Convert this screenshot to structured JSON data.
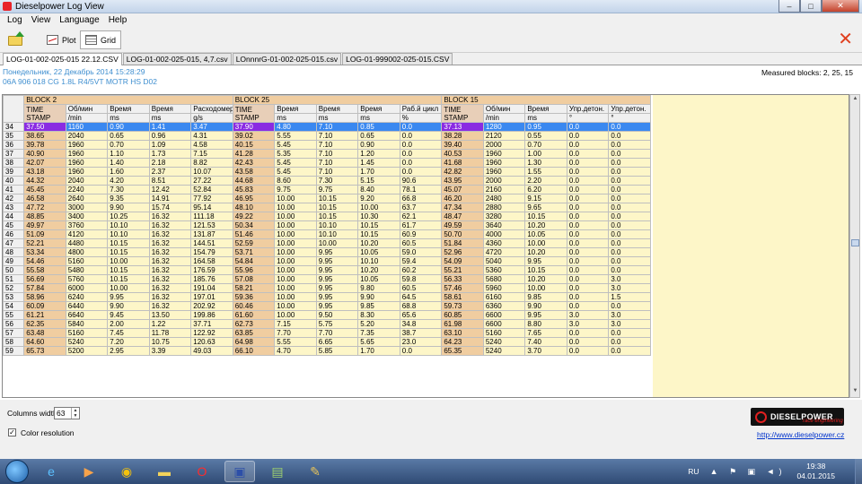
{
  "window": {
    "title": "Dieselpower Log View",
    "min": "‒",
    "max": "□",
    "close": "✕"
  },
  "menu": [
    "Log",
    "View",
    "Language",
    "Help"
  ],
  "toolbar": {
    "plot_label": "Plot",
    "grid_label": "Grid",
    "close": "✕"
  },
  "tabs": [
    "LOG-01-002-025-015 22.12.CSV",
    "LOG-01-002-025-015, 4,7.csv",
    "LOnnnrG-01-002-025-015.csv",
    "LOG-01-999002-025-015.CSV"
  ],
  "info": {
    "line1": "Понедельник, 22 Декабрь 2014 15:28:29",
    "line2": "06A 906 018 CG  1.8L R4/5VT MOTR HS D02",
    "measured": "Measured blocks: 2, 25, 15"
  },
  "grid": {
    "blocks": [
      {
        "label": "BLOCK 2",
        "cols": 5
      },
      {
        "label": "BLOCK 25",
        "cols": 5
      },
      {
        "label": "BLOCK 15",
        "cols": 5
      }
    ],
    "headers": [
      "TIME STAMP",
      "Об/мин",
      "Время",
      "Время",
      "Расходомер",
      "TIME STAMP",
      "Время",
      "Время",
      "Время",
      "Раб.й цикл",
      "TIME STAMP",
      "Об/мин",
      "Время",
      "Упр.детон.",
      "Упр.детон."
    ],
    "units": [
      "",
      "/min",
      "ms",
      "ms",
      "g/s",
      "",
      "ms",
      "ms",
      "ms",
      "%",
      "",
      "/min",
      "ms",
      "°",
      "°"
    ],
    "selected_row": "34",
    "rows": [
      [
        "34",
        "37.50",
        "1160",
        "0.90",
        "1.41",
        "3.47",
        "37.90",
        "4.80",
        "7.10",
        "0.85",
        "0.0",
        "37.13",
        "1280",
        "0.95",
        "0.0",
        "0.0"
      ],
      [
        "35",
        "38.65",
        "2040",
        "0.65",
        "0.96",
        "4.31",
        "39.02",
        "5.55",
        "7.10",
        "0.65",
        "0.0",
        "38.28",
        "2120",
        "0.55",
        "0.0",
        "0.0"
      ],
      [
        "36",
        "39.78",
        "1960",
        "0.70",
        "1.09",
        "4.58",
        "40.15",
        "5.45",
        "7.10",
        "0.90",
        "0.0",
        "39.40",
        "2000",
        "0.70",
        "0.0",
        "0.0"
      ],
      [
        "37",
        "40.90",
        "1960",
        "1.10",
        "1.73",
        "7.15",
        "41.28",
        "5.35",
        "7.10",
        "1.20",
        "0.0",
        "40.53",
        "1960",
        "1.00",
        "0.0",
        "0.0"
      ],
      [
        "38",
        "42.07",
        "1960",
        "1.40",
        "2.18",
        "8.82",
        "42.43",
        "5.45",
        "7.10",
        "1.45",
        "0.0",
        "41.68",
        "1960",
        "1.30",
        "0.0",
        "0.0"
      ],
      [
        "39",
        "43.18",
        "1960",
        "1.60",
        "2.37",
        "10.07",
        "43.58",
        "5.45",
        "7.10",
        "1.70",
        "0.0",
        "42.82",
        "1960",
        "1.55",
        "0.0",
        "0.0"
      ],
      [
        "40",
        "44.32",
        "2040",
        "4.20",
        "8.51",
        "27.22",
        "44.68",
        "8.60",
        "7.30",
        "5.15",
        "90.6",
        "43.95",
        "2000",
        "2.20",
        "0.0",
        "0.0"
      ],
      [
        "41",
        "45.45",
        "2240",
        "7.30",
        "12.42",
        "52.84",
        "45.83",
        "9.75",
        "9.75",
        "8.40",
        "78.1",
        "45.07",
        "2160",
        "6.20",
        "0.0",
        "0.0"
      ],
      [
        "42",
        "46.58",
        "2640",
        "9.35",
        "14.91",
        "77.92",
        "46.95",
        "10.00",
        "10.15",
        "9.20",
        "66.8",
        "46.20",
        "2480",
        "9.15",
        "0.0",
        "0.0"
      ],
      [
        "43",
        "47.72",
        "3000",
        "9.90",
        "15.74",
        "95.14",
        "48.10",
        "10.00",
        "10.15",
        "10.00",
        "63.7",
        "47.34",
        "2880",
        "9.65",
        "0.0",
        "0.0"
      ],
      [
        "44",
        "48.85",
        "3400",
        "10.25",
        "16.32",
        "111.18",
        "49.22",
        "10.00",
        "10.15",
        "10.30",
        "62.1",
        "48.47",
        "3280",
        "10.15",
        "0.0",
        "0.0"
      ],
      [
        "45",
        "49.97",
        "3760",
        "10.10",
        "16.32",
        "121.53",
        "50.34",
        "10.00",
        "10.10",
        "10.15",
        "61.7",
        "49.59",
        "3640",
        "10.20",
        "0.0",
        "0.0"
      ],
      [
        "46",
        "51.09",
        "4120",
        "10.10",
        "16.32",
        "131.87",
        "51.46",
        "10.00",
        "10.10",
        "10.15",
        "60.9",
        "50.70",
        "4000",
        "10.05",
        "0.0",
        "0.0"
      ],
      [
        "47",
        "52.21",
        "4480",
        "10.15",
        "16.32",
        "144.51",
        "52.59",
        "10.00",
        "10.00",
        "10.20",
        "60.5",
        "51.84",
        "4360",
        "10.00",
        "0.0",
        "0.0"
      ],
      [
        "48",
        "53.34",
        "4800",
        "10.15",
        "16.32",
        "154.79",
        "53.71",
        "10.00",
        "9.95",
        "10.05",
        "59.0",
        "52.96",
        "4720",
        "10.20",
        "0.0",
        "0.0"
      ],
      [
        "49",
        "54.46",
        "5160",
        "10.00",
        "16.32",
        "164.58",
        "54.84",
        "10.00",
        "9.95",
        "10.10",
        "59.4",
        "54.09",
        "5040",
        "9.95",
        "0.0",
        "0.0"
      ],
      [
        "50",
        "55.58",
        "5480",
        "10.15",
        "16.32",
        "176.59",
        "55.96",
        "10.00",
        "9.95",
        "10.20",
        "60.2",
        "55.21",
        "5360",
        "10.15",
        "0.0",
        "0.0"
      ],
      [
        "51",
        "56.69",
        "5760",
        "10.15",
        "16.32",
        "185.76",
        "57.08",
        "10.00",
        "9.95",
        "10.05",
        "59.8",
        "56.33",
        "5680",
        "10.20",
        "0.0",
        "3.0"
      ],
      [
        "52",
        "57.84",
        "6000",
        "10.00",
        "16.32",
        "191.04",
        "58.21",
        "10.00",
        "9.95",
        "9.80",
        "60.5",
        "57.46",
        "5960",
        "10.00",
        "0.0",
        "3.0"
      ],
      [
        "53",
        "58.96",
        "6240",
        "9.95",
        "16.32",
        "197.01",
        "59.36",
        "10.00",
        "9.95",
        "9.90",
        "64.5",
        "58.61",
        "6160",
        "9.85",
        "0.0",
        "1.5"
      ],
      [
        "54",
        "60.09",
        "6440",
        "9.90",
        "16.32",
        "202.92",
        "60.46",
        "10.00",
        "9.95",
        "9.85",
        "68.8",
        "59.73",
        "6360",
        "9.90",
        "0.0",
        "0.0"
      ],
      [
        "55",
        "61.21",
        "6640",
        "9.45",
        "13.50",
        "199.86",
        "61.60",
        "10.00",
        "9.50",
        "8.30",
        "65.6",
        "60.85",
        "6600",
        "9.95",
        "3.0",
        "3.0"
      ],
      [
        "56",
        "62.35",
        "5840",
        "2.00",
        "1.22",
        "37.71",
        "62.73",
        "7.15",
        "5.75",
        "5.20",
        "34.8",
        "61.98",
        "6600",
        "8.80",
        "3.0",
        "3.0"
      ],
      [
        "57",
        "63.48",
        "5160",
        "7.45",
        "11.78",
        "122.92",
        "63.85",
        "7.70",
        "7.70",
        "7.35",
        "38.7",
        "63.10",
        "5160",
        "7.65",
        "0.0",
        "0.0"
      ],
      [
        "58",
        "64.60",
        "5240",
        "7.20",
        "10.75",
        "120.63",
        "64.98",
        "5.55",
        "6.65",
        "5.65",
        "23.0",
        "64.23",
        "5240",
        "7.40",
        "0.0",
        "0.0"
      ],
      [
        "59",
        "65.73",
        "5200",
        "2.95",
        "3.39",
        "49.03",
        "66.10",
        "4.70",
        "5.85",
        "1.70",
        "0.0",
        "65.35",
        "5240",
        "3.70",
        "0.0",
        "0.0"
      ]
    ]
  },
  "bottom": {
    "columns_width_label": "Columns width:",
    "columns_width_value": "63",
    "color_resolution_label": "Color resolution",
    "color_resolution_checked": "✓",
    "logo_text": "DIESELPOWER",
    "logo_sub": "race engineering",
    "url": "http://www.dieselpower.cz"
  },
  "taskbar": {
    "lang": "RU",
    "tray": "▲ ⚑ ▣ ◄)",
    "time": "19:38",
    "date": "04.01.2015",
    "icons": [
      "ie-icon",
      "media-icon",
      "chrome-icon",
      "folder-icon",
      "opera-icon",
      "save-icon",
      "app-icon",
      "paint-icon"
    ]
  }
}
